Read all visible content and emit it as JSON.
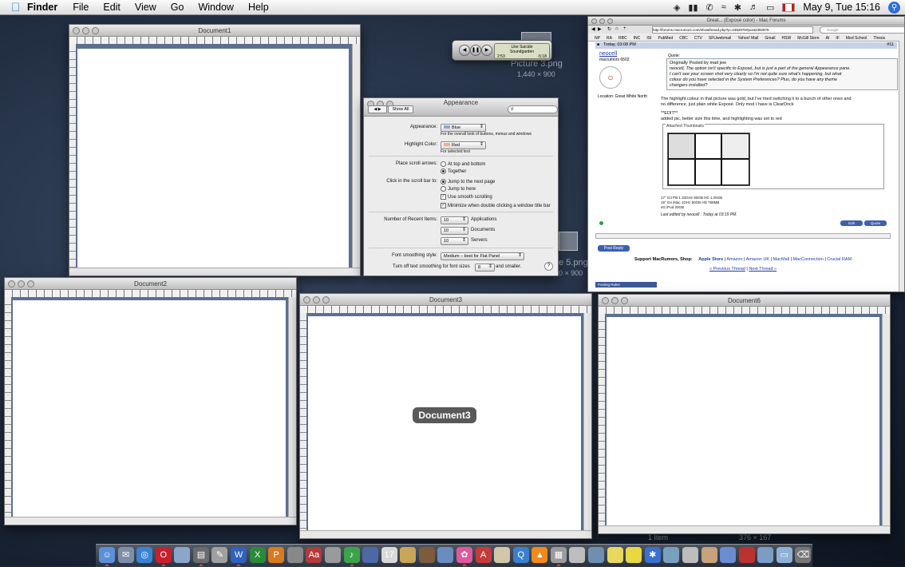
{
  "menubar": {
    "app": "Finder",
    "items": [
      "File",
      "Edit",
      "View",
      "Go",
      "Window",
      "Help"
    ],
    "clock": "May 9, Tue 15:16"
  },
  "windows": {
    "doc1": "Document1",
    "doc2": "Document2",
    "doc3": "Document3",
    "doc6": "Document6",
    "doc3_label": "Document3"
  },
  "ghosts": {
    "pic3": "Picture 3.png",
    "pic3_size": "1,440 × 900",
    "pic5": "e 5.png",
    "pic5_size": "0 × 900",
    "extra1": "1 Item",
    "extra2": "376 × 167"
  },
  "itunes": {
    "line1": "Like Suicide",
    "line2": "Soundgarden",
    "elapsed": "2:53",
    "remaining": "-5:18"
  },
  "prefs": {
    "title": "Appearance",
    "show_all": "Show All",
    "appearance_label": "Appearance:",
    "appearance_value": "Blue",
    "appearance_help": "For the overall look of buttons, menus and windows",
    "highlight_label": "Highlight Color:",
    "highlight_value": "Red",
    "highlight_help": "For selected text",
    "scroll_arrows_label": "Place scroll arrows:",
    "scroll_opt1": "At top and bottom",
    "scroll_opt2": "Together",
    "click_label": "Click in the scroll bar to:",
    "click_opt1": "Jump to the next page",
    "click_opt2": "Jump to here",
    "smooth_scroll": "Use smooth scrolling",
    "minimize": "Minimize when double clicking a window title bar",
    "recent_label": "Number of Recent Items:",
    "recent_apps": "10",
    "recent_apps_label": "Applications",
    "recent_docs": "10",
    "recent_docs_label": "Documents",
    "recent_servers": "10",
    "recent_servers_label": "Servers",
    "font_smooth_label": "Font smoothing style:",
    "font_smooth_value": "Medium – best for Flat Panel",
    "turn_off_label": "Turn off text smoothing for font sizes",
    "turn_off_value": "8",
    "turn_off_suffix": "and smaller.",
    "help": "?"
  },
  "browser": {
    "title": "Great... (Exposé color) - Mac Forums",
    "url": "http://forums.macrumors.com/showthread.php?p=2392976#post2392976",
    "search_placeholder": "Google",
    "bookmarks": [
      "NP",
      "RA",
      "RBC",
      "INC",
      "ISI",
      "PubMed",
      "CBC",
      "CTV",
      "SFUwebmail",
      "Yahoo! Mail",
      "Gmail",
      "HSW",
      "McGill Store",
      "AI",
      "IF",
      "Med School",
      "Thesis"
    ],
    "post_date": "Today, 03:08 PM",
    "post_num": "#11",
    "username": "neocell",
    "user_title": "macrumors 6502",
    "location": "Location: Great White North",
    "quote_header": "Quote:",
    "quote_by": "Originally Posted by mad jew",
    "quote_text_1": "neocell, The option isn't specific to Exposé, but is just a part of the general Appearance pane.",
    "quote_text_2": "I can't see your screen shot very clearly so I'm not quite sure what's happening, but what",
    "quote_text_3": "colour do you have selected in the System Preferences? Plus, do you have any theme",
    "quote_text_4": "changers installed?",
    "body_1": "The highlight colour in that picture was gold, but I've tried switching it to a bunch of other ones and",
    "body_2": "no difference, just plain white Exposé. Only mod I have is ClearDock",
    "edit_mark": "**EDIT**",
    "body_3": "added pic, better size this time, and highlighting was set to red",
    "attached": "Attached Thumbnails",
    "sig_1": "17\" G4 PB 1.33GHz 80GB HD 1.25GB",
    "sig_2": "15\" G4 iMac 1GHz 80GB HD 768MB",
    "sig_3": "4G iPod 20GB",
    "last_edited": "Last edited by neocell : Today at 03:15 PM.",
    "edit_btn": "Edit",
    "quote_btn": "Quote",
    "reply_btn": "Post Reply",
    "support_label": "Support MacRumors, Shop:",
    "shops": [
      "Apple Store",
      "Amazon",
      "Amazon UK",
      "MacMall",
      "MacConnection",
      "Crucial RAM"
    ],
    "prev_thread": "« Previous Thread",
    "next_thread": "Next Thread »",
    "posting_rules": "Posting Rules"
  },
  "dock": {
    "items": [
      "finder-icon",
      "mail-icon",
      "safari-icon",
      "opera-icon",
      "iphoto-icon",
      "printer-icon",
      "pen-icon",
      "word-icon",
      "excel-icon",
      "powerpoint-icon",
      "script-icon",
      "dictionary-icon",
      "news-icon",
      "itunes-icon",
      "grapher-icon",
      "ical-icon",
      "notes-icon",
      "brush-icon",
      "preview-icon",
      "flower-icon",
      "acrobat-icon",
      "photo-icon",
      "quicktime-icon",
      "vlc-icon",
      "calculator-icon",
      "utility-icon",
      "system-icon",
      "notes2-icon",
      "stickies-icon",
      "bluetooth-icon",
      "app-icon",
      "airport-icon",
      "package-icon",
      "finder2-icon",
      "activity-icon",
      "stack-icon",
      "folder-icon",
      "trash-icon"
    ],
    "colors": [
      "#5b8fd8",
      "#7d8fa8",
      "#3b82d6",
      "#c8202b",
      "#8aa6c8",
      "#6b6b6b",
      "#a0a0a0",
      "#2f61c1",
      "#2a8a3a",
      "#d97a1e",
      "#888888",
      "#b33a3a",
      "#9a9a9a",
      "#3ca34a",
      "#4b6aa5",
      "#d8d8d8",
      "#c9a55a",
      "#7c5c3c",
      "#6a8cc0",
      "#e0589b",
      "#c63a3a",
      "#d0c8a8",
      "#3a7fd0",
      "#f08a1c",
      "#9b9b9b",
      "#bdbdbd",
      "#6f8fb0",
      "#e7d860",
      "#e9d842",
      "#3b6fd0",
      "#7aa0c0",
      "#bdbdbd",
      "#c7a27a",
      "#6a8cd0",
      "#bf3030",
      "#7c9cc4",
      "#8fb0d8",
      "#777777"
    ]
  }
}
